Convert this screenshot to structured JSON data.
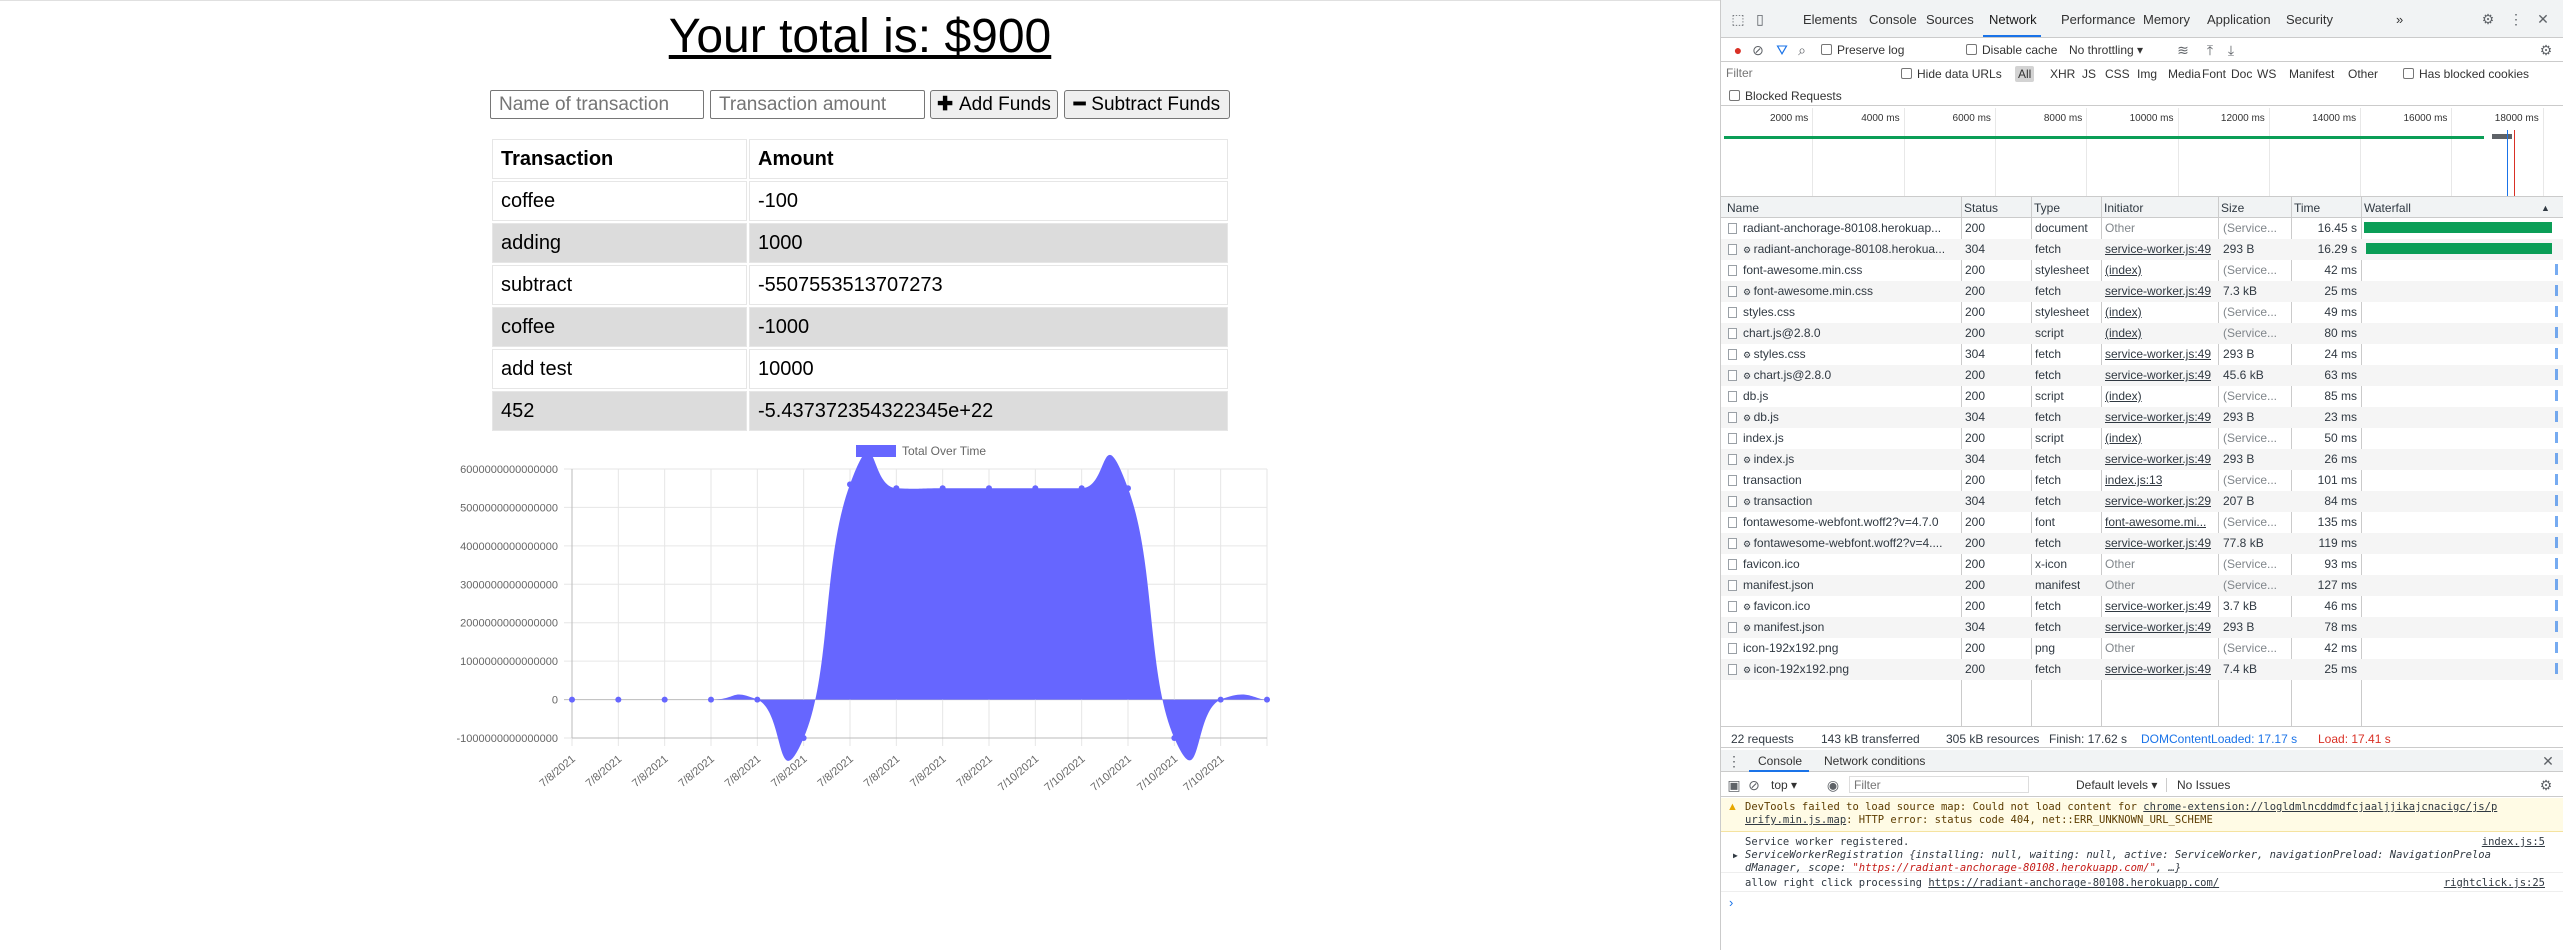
{
  "app": {
    "total_text": "Your total is: $900",
    "name_placeholder": "Name of transaction",
    "amount_placeholder": "Transaction amount",
    "add_label": "Add Funds",
    "subtract_label": "Subtract Funds",
    "table_headers": [
      "Transaction",
      "Amount"
    ],
    "rows": [
      {
        "name": "coffee",
        "amount": "-100"
      },
      {
        "name": "adding",
        "amount": "1000"
      },
      {
        "name": "subtract",
        "amount": "-5507553513707273"
      },
      {
        "name": "coffee",
        "amount": "-1000"
      },
      {
        "name": "add test",
        "amount": "10000"
      },
      {
        "name": "452",
        "amount": "-5.437372354322345e+22"
      }
    ]
  },
  "chart_data": {
    "type": "area",
    "series": [
      {
        "name": "Total Over Time",
        "color": "#6666ff",
        "values": [
          0,
          0,
          0,
          0,
          0,
          -1000000000000000,
          5600000000000000,
          5500000000000000,
          5500000000000000,
          5500000000000000,
          5500000000000000,
          5500000000000000,
          5500000000000000,
          -1000000000000000,
          0,
          0
        ]
      }
    ],
    "categories": [
      "7/8/2021",
      "7/8/2021",
      "7/8/2021",
      "7/8/2021",
      "7/8/2021",
      "7/8/2021",
      "7/8/2021",
      "7/8/2021",
      "7/8/2021",
      "7/8/2021",
      "7/10/2021",
      "7/10/2021",
      "7/10/2021",
      "7/10/2021",
      "7/10/2021"
    ],
    "yticks": [
      "6000000000000000",
      "5000000000000000",
      "4000000000000000",
      "3000000000000000",
      "2000000000000000",
      "1000000000000000",
      "0",
      "-1000000000000000"
    ],
    "ylim": [
      -1000000000000000,
      6000000000000000
    ],
    "legend_position": "top",
    "grid": true
  },
  "devtools": {
    "tabs": [
      "Elements",
      "Console",
      "Sources",
      "Network",
      "Performance",
      "Memory",
      "Application",
      "Security"
    ],
    "active_tab": "Network",
    "more": "»",
    "preserve_log": "Preserve log",
    "disable_cache": "Disable cache",
    "throttling": "No throttling",
    "filter_placeholder": "Filter",
    "hide_data_urls": "Hide data URLs",
    "type_filters": [
      "All",
      "XHR",
      "JS",
      "CSS",
      "Img",
      "Media",
      "Font",
      "Doc",
      "WS",
      "Manifest",
      "Other"
    ],
    "has_blocked_cookies": "Has blocked cookies",
    "blocked_requests": "Blocked Requests",
    "timeline_ticks": [
      "2000 ms",
      "4000 ms",
      "6000 ms",
      "8000 ms",
      "10000 ms",
      "12000 ms",
      "14000 ms",
      "16000 ms",
      "18000 ms"
    ],
    "columns": [
      "Name",
      "Status",
      "Type",
      "Initiator",
      "Size",
      "Time",
      "Waterfall"
    ],
    "requests": [
      {
        "name": "radiant-anchorage-80108.herokuap...",
        "gear": false,
        "status": "200",
        "type": "document",
        "initiator": "Other",
        "initiator_link": false,
        "size": "(Service...",
        "time": "16.45 s",
        "wf": 1.0
      },
      {
        "name": "radiant-anchorage-80108.herokua...",
        "gear": true,
        "status": "304",
        "type": "fetch",
        "initiator": "service-worker.js:49",
        "initiator_link": true,
        "size": "293 B",
        "time": "16.29 s",
        "wf": 0.99
      },
      {
        "name": "font-awesome.min.css",
        "gear": false,
        "status": "200",
        "type": "stylesheet",
        "initiator": "(index)",
        "initiator_link": true,
        "size": "(Service...",
        "time": "42 ms",
        "wf": 0
      },
      {
        "name": "font-awesome.min.css",
        "gear": true,
        "status": "200",
        "type": "fetch",
        "initiator": "service-worker.js:49",
        "initiator_link": true,
        "size": "7.3 kB",
        "time": "25 ms",
        "wf": 0
      },
      {
        "name": "styles.css",
        "gear": false,
        "status": "200",
        "type": "stylesheet",
        "initiator": "(index)",
        "initiator_link": true,
        "size": "(Service...",
        "time": "49 ms",
        "wf": 0
      },
      {
        "name": "chart.js@2.8.0",
        "gear": false,
        "status": "200",
        "type": "script",
        "initiator": "(index)",
        "initiator_link": true,
        "size": "(Service...",
        "time": "80 ms",
        "wf": 0
      },
      {
        "name": "styles.css",
        "gear": true,
        "status": "304",
        "type": "fetch",
        "initiator": "service-worker.js:49",
        "initiator_link": true,
        "size": "293 B",
        "time": "24 ms",
        "wf": 0
      },
      {
        "name": "chart.js@2.8.0",
        "gear": true,
        "status": "200",
        "type": "fetch",
        "initiator": "service-worker.js:49",
        "initiator_link": true,
        "size": "45.6 kB",
        "time": "63 ms",
        "wf": 0
      },
      {
        "name": "db.js",
        "gear": false,
        "status": "200",
        "type": "script",
        "initiator": "(index)",
        "initiator_link": true,
        "size": "(Service...",
        "time": "85 ms",
        "wf": 0
      },
      {
        "name": "db.js",
        "gear": true,
        "status": "304",
        "type": "fetch",
        "initiator": "service-worker.js:49",
        "initiator_link": true,
        "size": "293 B",
        "time": "23 ms",
        "wf": 0
      },
      {
        "name": "index.js",
        "gear": false,
        "status": "200",
        "type": "script",
        "initiator": "(index)",
        "initiator_link": true,
        "size": "(Service...",
        "time": "50 ms",
        "wf": 0
      },
      {
        "name": "index.js",
        "gear": true,
        "status": "304",
        "type": "fetch",
        "initiator": "service-worker.js:49",
        "initiator_link": true,
        "size": "293 B",
        "time": "26 ms",
        "wf": 0
      },
      {
        "name": "transaction",
        "gear": false,
        "status": "200",
        "type": "fetch",
        "initiator": "index.js:13",
        "initiator_link": true,
        "size": "(Service...",
        "time": "101 ms",
        "wf": 0
      },
      {
        "name": "transaction",
        "gear": true,
        "status": "304",
        "type": "fetch",
        "initiator": "service-worker.js:29",
        "initiator_link": true,
        "size": "207 B",
        "time": "84 ms",
        "wf": 0
      },
      {
        "name": "fontawesome-webfont.woff2?v=4.7.0",
        "gear": false,
        "status": "200",
        "type": "font",
        "initiator": "font-awesome.mi...",
        "initiator_link": true,
        "size": "(Service...",
        "time": "135 ms",
        "wf": 0
      },
      {
        "name": "fontawesome-webfont.woff2?v=4....",
        "gear": true,
        "status": "200",
        "type": "fetch",
        "initiator": "service-worker.js:49",
        "initiator_link": true,
        "size": "77.8 kB",
        "time": "119 ms",
        "wf": 0
      },
      {
        "name": "favicon.ico",
        "gear": false,
        "status": "200",
        "type": "x-icon",
        "initiator": "Other",
        "initiator_link": false,
        "size": "(Service...",
        "time": "93 ms",
        "wf": 0
      },
      {
        "name": "manifest.json",
        "gear": false,
        "status": "200",
        "type": "manifest",
        "initiator": "Other",
        "initiator_link": false,
        "size": "(Service...",
        "time": "127 ms",
        "wf": 0
      },
      {
        "name": "favicon.ico",
        "gear": true,
        "status": "200",
        "type": "fetch",
        "initiator": "service-worker.js:49",
        "initiator_link": true,
        "size": "3.7 kB",
        "time": "46 ms",
        "wf": 0
      },
      {
        "name": "manifest.json",
        "gear": true,
        "status": "304",
        "type": "fetch",
        "initiator": "service-worker.js:49",
        "initiator_link": true,
        "size": "293 B",
        "time": "78 ms",
        "wf": 0
      },
      {
        "name": "icon-192x192.png",
        "gear": false,
        "status": "200",
        "type": "png",
        "initiator": "Other",
        "initiator_link": false,
        "size": "(Service...",
        "time": "42 ms",
        "wf": 0
      },
      {
        "name": "icon-192x192.png",
        "gear": true,
        "status": "200",
        "type": "fetch",
        "initiator": "service-worker.js:49",
        "initiator_link": true,
        "size": "7.4 kB",
        "time": "25 ms",
        "wf": 0
      }
    ],
    "summary": {
      "requests": "22 requests",
      "transferred": "143 kB transferred",
      "resources": "305 kB resources",
      "finish": "Finish: 17.62 s",
      "dcl": "DOMContentLoaded: 17.17 s",
      "load": "Load: 17.41 s"
    },
    "drawer_tabs": [
      "Console",
      "Network conditions"
    ],
    "context": "top",
    "console_filter": "Filter",
    "levels": "Default levels",
    "issues": "No Issues",
    "messages": {
      "warn1": "DevTools failed to load source map: Could not load content for ",
      "warn_link": "chrome-extension://logldmlncddmdfcjaaljjikajcnacigc/js/p",
      "warn2": "urify.min.js.map",
      "warn3": ": HTTP error: status code 404, net::ERR_UNKNOWN_URL_SCHEME",
      "sw": "Service worker registered.",
      "sw_src": "index.js:5",
      "reg1": "ServiceWorkerRegistration {installing: null, waiting: null, active: ServiceWorker, navigationPreload: NavigationPreloa",
      "reg2": "dManager, scope: ",
      "reg_scope": "\"https://radiant-anchorage-80108.herokuapp.com/\"",
      "reg3": ", …}",
      "rc": "allow right click processing ",
      "rc_link": "https://radiant-anchorage-80108.herokuapp.com/",
      "rc_src": "rightclick.js:25"
    }
  }
}
